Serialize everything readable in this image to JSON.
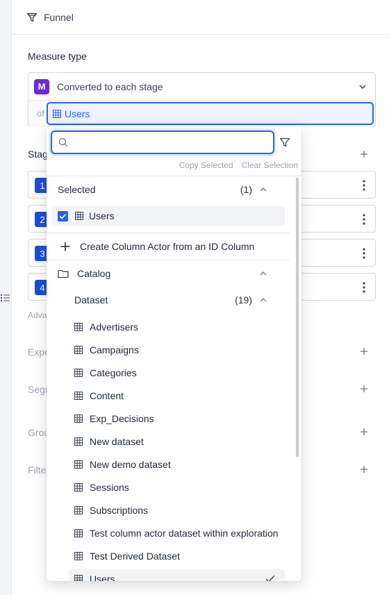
{
  "header": {
    "title": "Funnel",
    "icon": "funnel-icon"
  },
  "measure": {
    "label": "Measure type",
    "badge": "M",
    "badge_color": "#6d28d9",
    "value": "Converted to each stage",
    "of_label": "of",
    "actor": "Users"
  },
  "background": {
    "stages_label": "Stag",
    "stages": [
      "1",
      "2",
      "3",
      "4"
    ],
    "advanced_label": "Adva",
    "expressions_label": "Expe",
    "segments_label": "Segm",
    "group_label": "Grou",
    "filters_label": "Filte"
  },
  "dropdown": {
    "search": {
      "value": "",
      "placeholder": ""
    },
    "copy_selected": "Copy Selected",
    "clear_selection": "Clear Selection",
    "selected_header": "Selected",
    "selected_count": "(1)",
    "selected_items": [
      {
        "label": "Users",
        "checked": true
      }
    ],
    "create_column_actor": "Create Column Actor from an ID Column",
    "catalog_label": "Catalog",
    "dataset_label": "Dataset",
    "dataset_count": "(19)",
    "datasets": [
      "Advertisers",
      "Campaigns",
      "Categories",
      "Content",
      "Exp_Decisions",
      "New dataset",
      "New demo dataset",
      "Sessions",
      "Subscriptions",
      "Test column actor dataset within exploration",
      "Test Derived Dataset",
      "Users"
    ],
    "selected_dataset": "Users"
  },
  "colors": {
    "accent": "#2563eb",
    "stage_badge": "#1d4ed8",
    "selected_bg": "#f3f4f6"
  }
}
